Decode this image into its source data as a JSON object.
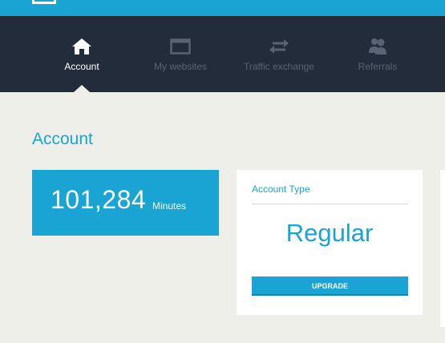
{
  "nav": {
    "items": [
      {
        "label": "Account",
        "icon": "home-icon",
        "active": true
      },
      {
        "label": "My websites",
        "icon": "browser-window-icon",
        "active": false
      },
      {
        "label": "Traffic exchange",
        "icon": "exchange-arrows-icon",
        "active": false
      },
      {
        "label": "Referrals",
        "icon": "users-icon",
        "active": false
      }
    ]
  },
  "page": {
    "title": "Account"
  },
  "minutes": {
    "value": "101,284",
    "unit": "Minutes"
  },
  "account_type": {
    "heading": "Account Type",
    "value": "Regular",
    "button_label": "UPGRADE"
  },
  "colors": {
    "accent": "#1aa4d4",
    "nav_bg": "#232c3b",
    "page_bg": "#efefea"
  }
}
